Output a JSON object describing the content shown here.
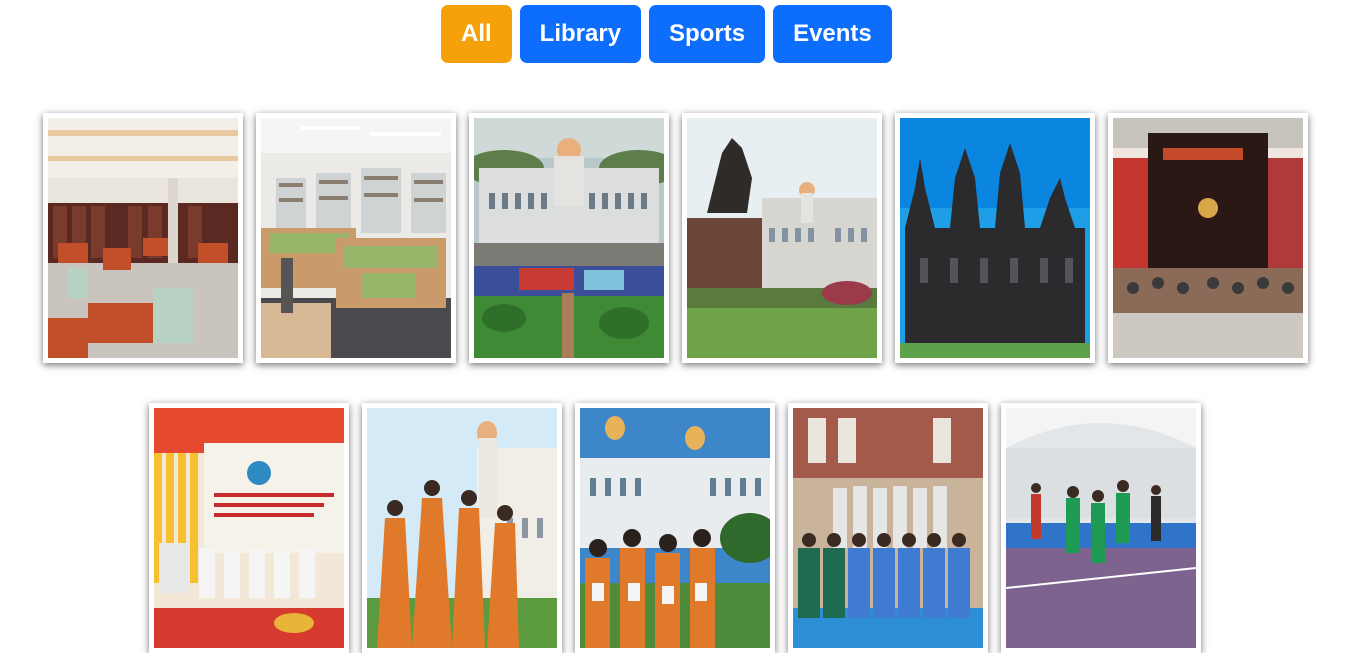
{
  "filters": [
    {
      "label": "All",
      "active": true
    },
    {
      "label": "Library",
      "active": false
    },
    {
      "label": "Sports",
      "active": false
    },
    {
      "label": "Events",
      "active": false
    }
  ],
  "gallery": {
    "row1": [
      {
        "subject": "library-reading-hall",
        "category": "library"
      },
      {
        "subject": "library-lounge",
        "category": "library"
      },
      {
        "subject": "campus-aerial-view",
        "category": "events"
      },
      {
        "subject": "equestrian-statue",
        "category": "events"
      },
      {
        "subject": "heritage-building",
        "category": "events"
      },
      {
        "subject": "convocation-stage",
        "category": "events"
      }
    ],
    "row2": [
      {
        "subject": "seminar-stage",
        "category": "events"
      },
      {
        "subject": "graduates-celebration",
        "category": "events"
      },
      {
        "subject": "students-with-certificates",
        "category": "events"
      },
      {
        "subject": "sports-team-group",
        "category": "sports"
      },
      {
        "subject": "kabaddi-match",
        "category": "sports"
      }
    ]
  },
  "colors": {
    "active_filter": "#f7a10a",
    "filter": "#0d6efd"
  }
}
